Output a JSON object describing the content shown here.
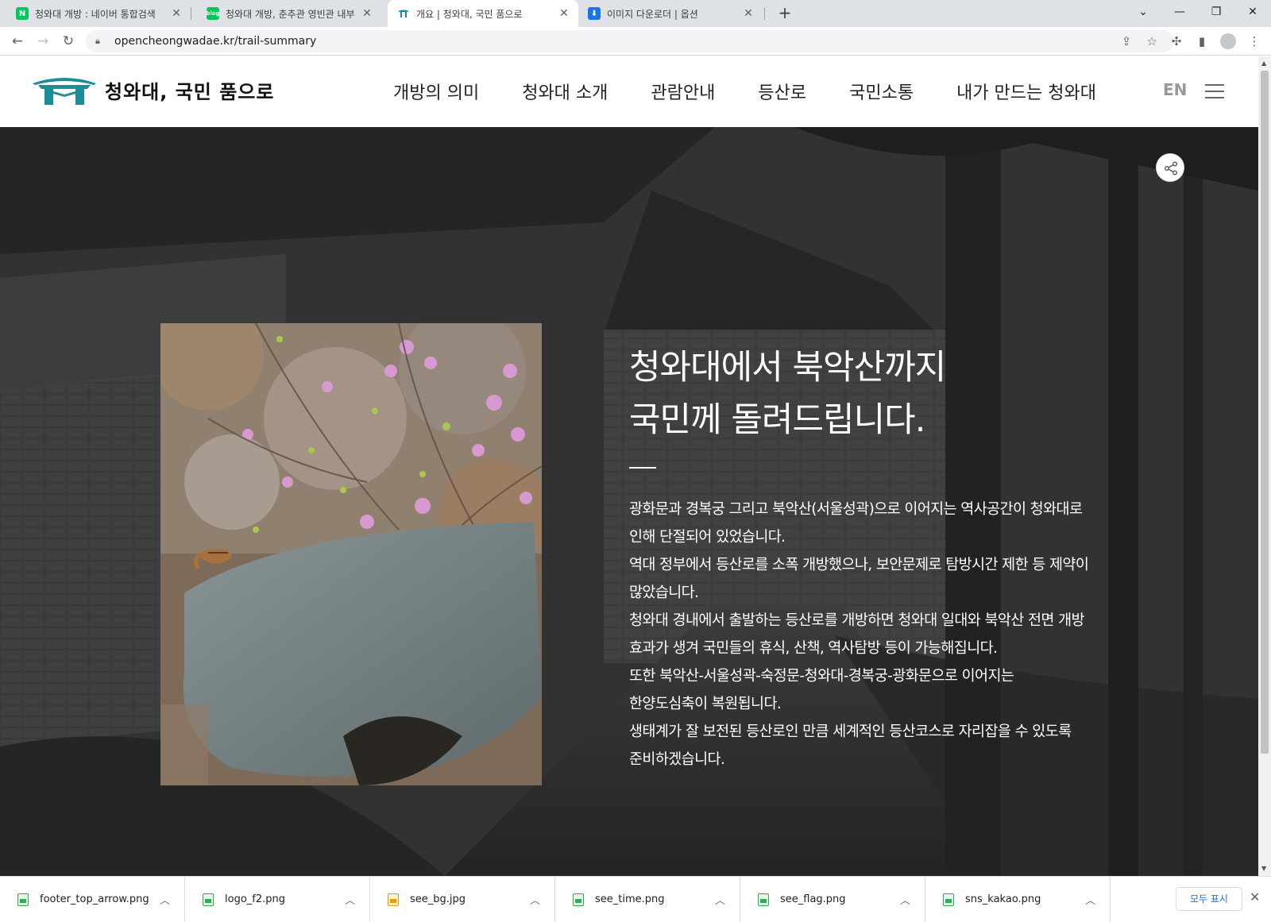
{
  "browser": {
    "tabs": [
      {
        "title": "청와대 개방 : 네이버 통합검색",
        "favicon": "naver-icon",
        "color": "#03c75a"
      },
      {
        "title": "청와대 개방, 춘추관 영빈관 내부",
        "favicon": "naver-blog-icon",
        "color": "#03c75a"
      },
      {
        "title": "개요 | 청와대, 국민 품으로",
        "favicon": "cheongwadae-icon",
        "color": "#1a8a9a"
      },
      {
        "title": "이미지 다운로더 | 옵션",
        "favicon": "download-icon",
        "color": "#1a73e8"
      }
    ],
    "url": "opencheongwadae.kr/trail-summary"
  },
  "site": {
    "logo_text": "청와대, 국민 품으로",
    "nav": [
      "개방의 의미",
      "청와대 소개",
      "관람안내",
      "등산로",
      "국민소통",
      "내가 만드는 청와대"
    ],
    "lang": "EN"
  },
  "hero": {
    "title_line1": "청와대에서 북악산까지",
    "title_line2": "국민께 돌려드립니다.",
    "body": [
      "광화문과 경복궁 그리고 북악산(서울성곽)으로 이어지는 역사공간이 청와대로",
      "인해 단절되어 있었습니다.",
      "역대 정부에서 등산로를 소폭 개방했으나, 보안문제로 탐방시간 제한 등 제약이",
      "많았습니다.",
      "청와대 경내에서 출발하는 등산로를 개방하면 청와대 일대와 북악산 전면 개방",
      "효과가 생겨 국민들의 휴식, 산책, 역사탐방 등이 가능해집니다.",
      "또한 북악산-서울성곽-숙정문-청와대-경복궁-광화문으로 이어지는",
      "한양도심축이 복원됩니다.",
      "생태계가 잘 보전된 등산로인 만큼 세계적인 등산코스로 자리잡을 수 있도록",
      "준비하겠습니다."
    ]
  },
  "downloads": {
    "items": [
      {
        "name": "footer_top_arrow.png",
        "type": "png"
      },
      {
        "name": "logo_f2.png",
        "type": "png"
      },
      {
        "name": "see_bg.jpg",
        "type": "jpg"
      },
      {
        "name": "see_time.png",
        "type": "png"
      },
      {
        "name": "see_flag.png",
        "type": "png"
      },
      {
        "name": "sns_kakao.png",
        "type": "png"
      }
    ],
    "show_all": "모두 표시"
  }
}
